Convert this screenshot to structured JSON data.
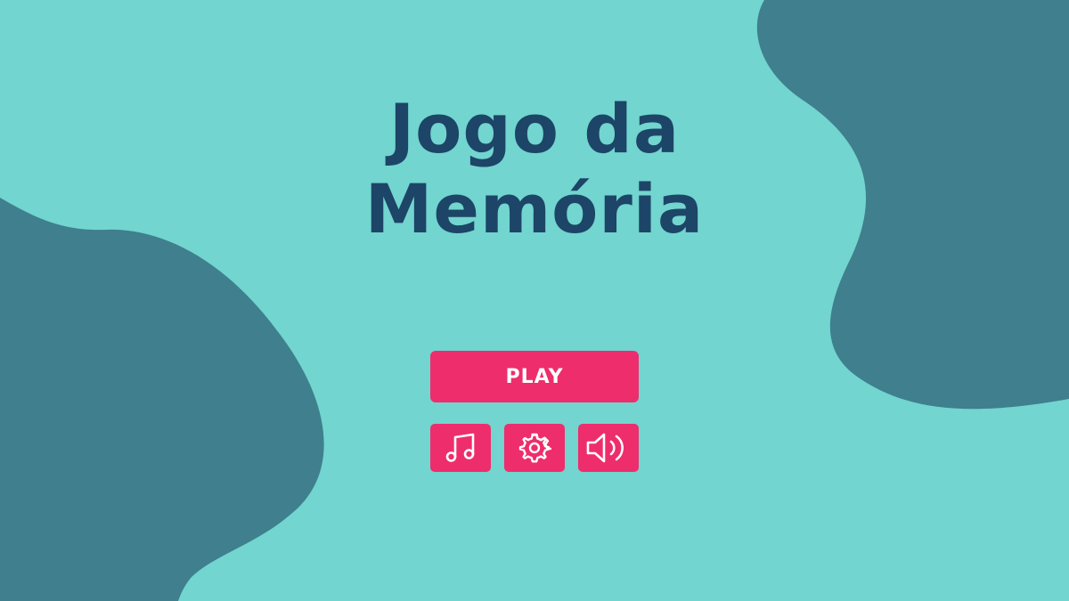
{
  "title": {
    "line1": "Jogo da",
    "line2": "Memória"
  },
  "buttons": {
    "play_label": "PLAY",
    "music_icon": "music-note-icon",
    "settings_icon": "gear-icon",
    "volume_icon": "speaker-volume-icon"
  },
  "colors": {
    "background": "#72d5cf",
    "blob": "#3f7f8e",
    "title": "#1d4567",
    "button": "#ee2d6d",
    "button_text": "#ffffff"
  }
}
